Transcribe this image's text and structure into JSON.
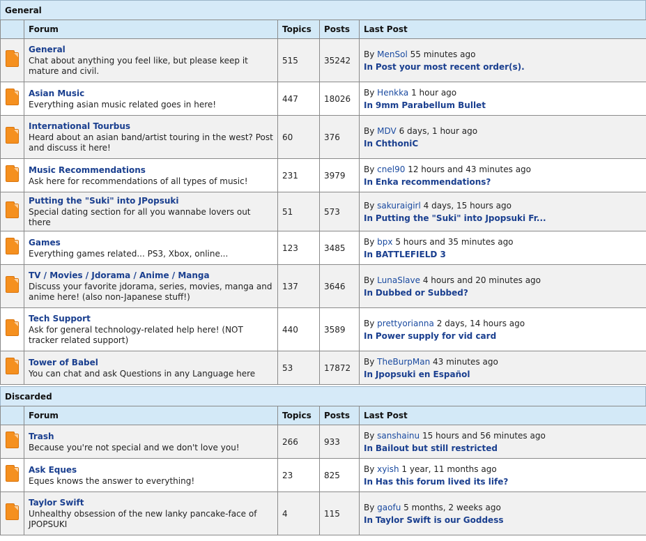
{
  "general": {
    "title": "General",
    "headers": {
      "forum": "Forum",
      "topics": "Topics",
      "posts": "Posts",
      "last": "Last Post"
    },
    "by": "By",
    "in": "In",
    "forums": [
      {
        "name": "General",
        "desc": "Chat about anything you feel like, but please keep it mature and civil.",
        "topics": "515",
        "posts": "35242",
        "user": "MenSol",
        "time": "55 minutes ago",
        "thread": "Post your most recent order(s)."
      },
      {
        "name": "Asian Music",
        "desc": "Everything asian music related goes in here!",
        "topics": "447",
        "posts": "18026",
        "user": "Henkka",
        "time": "1 hour ago",
        "thread": "9mm Parabellum Bullet"
      },
      {
        "name": "International Tourbus",
        "desc": "Heard about an asian band/artist touring in the west? Post and discuss it here!",
        "topics": "60",
        "posts": "376",
        "user": "MDV",
        "time": "6 days, 1 hour ago",
        "thread": "ChthoniC"
      },
      {
        "name": "Music Recommendations",
        "desc": "Ask here for recommendations of all types of music!",
        "topics": "231",
        "posts": "3979",
        "user": "cnel90",
        "time": "12 hours and 43 minutes ago",
        "thread": "Enka recommendations?"
      },
      {
        "name": "Putting the \"Suki\" into JPopsuki",
        "desc": "Special dating section for all you wannabe lovers out there",
        "topics": "51",
        "posts": "573",
        "user": "sakuraigirl",
        "time": "4 days, 15 hours ago",
        "thread": "Putting the \"Suki\" into Jpopsuki Fr..."
      },
      {
        "name": "Games",
        "desc": "Everything games related... PS3, Xbox, online...",
        "topics": "123",
        "posts": "3485",
        "user": "bpx",
        "time": "5 hours and 35 minutes ago",
        "thread": "BATTLEFIELD 3"
      },
      {
        "name": "TV / Movies / Jdorama / Anime / Manga",
        "desc": "Discuss your favorite jdorama, series, movies, manga and anime here! (also non-Japanese stuff!)",
        "topics": "137",
        "posts": "3646",
        "user": "LunaSlave",
        "time": "4 hours and 20 minutes ago",
        "thread": "Dubbed or Subbed?"
      },
      {
        "name": "Tech Support",
        "desc": "Ask for general technology-related help here! (NOT tracker related support)",
        "topics": "440",
        "posts": "3589",
        "user": "prettyorianna",
        "time": "2 days, 14 hours ago",
        "thread": "Power supply for vid card"
      },
      {
        "name": "Tower of Babel",
        "desc": "You can chat and ask Questions in any Language here",
        "topics": "53",
        "posts": "17872",
        "user": "TheBurpMan",
        "time": "43 minutes ago",
        "thread": "Jpopsuki en Español"
      }
    ]
  },
  "discarded": {
    "title": "Discarded",
    "headers": {
      "forum": "Forum",
      "topics": "Topics",
      "posts": "Posts",
      "last": "Last Post"
    },
    "by": "By",
    "in": "In",
    "forums": [
      {
        "name": "Trash",
        "desc": "Because you're not special and we don't love you!",
        "topics": "266",
        "posts": "933",
        "user": "sanshainu",
        "time": "15 hours and 56 minutes ago",
        "thread": "Bailout but still restricted"
      },
      {
        "name": "Ask Eques",
        "desc": "Eques knows the answer to everything!",
        "topics": "23",
        "posts": "825",
        "user": "xyish",
        "time": "1 year, 11 months ago",
        "thread": "Has this forum lived its life?"
      },
      {
        "name": "Taylor Swift",
        "desc": "Unhealthy obsession of the new lanky pancake-face of JPOPSUKI",
        "topics": "4",
        "posts": "115",
        "user": "gaofu",
        "time": "5 months, 2 weeks ago",
        "thread": "Taylor Swift is our Goddess"
      }
    ]
  },
  "colors": {
    "header_bg": "#d3e9f7",
    "row_alt": "#f1f1f1",
    "link": "#1a3f8f",
    "folder_icon": "#f5901f"
  }
}
